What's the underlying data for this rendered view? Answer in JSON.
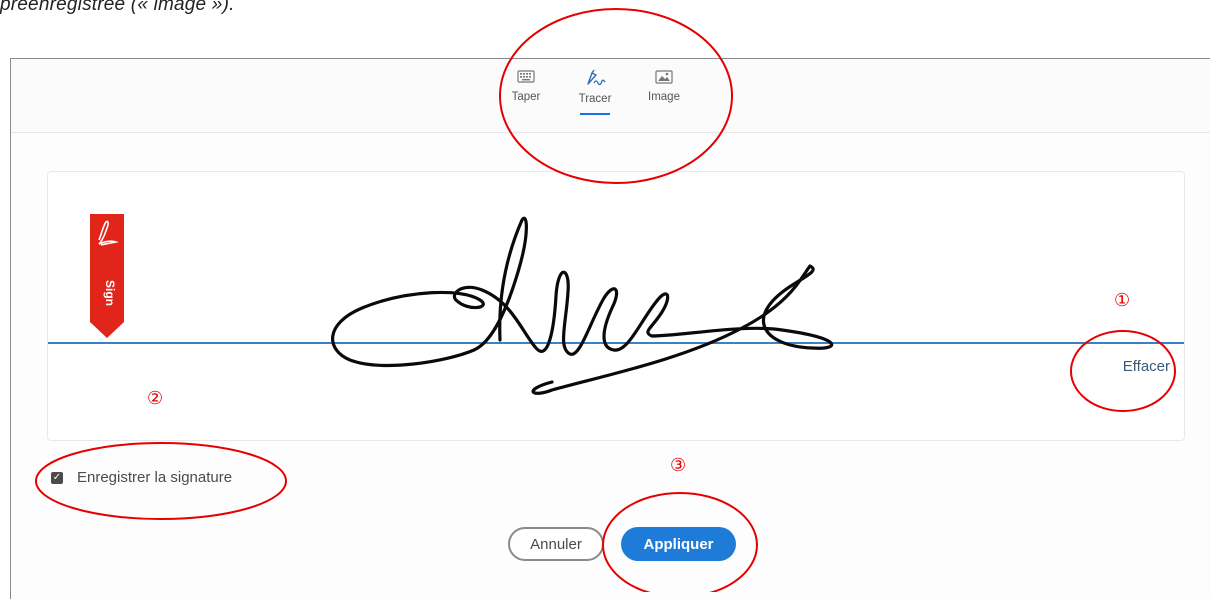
{
  "caption": "préenregistrée (« image »).",
  "tabs": [
    {
      "label": "Taper",
      "icon": "keyboard-icon",
      "active": false
    },
    {
      "label": "Tracer",
      "icon": "pen-icon",
      "active": true
    },
    {
      "label": "Image",
      "icon": "image-icon",
      "active": false
    }
  ],
  "sign_badge": {
    "label": "Sign",
    "icon": "acrobat-icon",
    "color": "#e1251b"
  },
  "signature_area": {
    "clear_label": "Effacer",
    "baseline_color": "#3b82c4"
  },
  "save_signature": {
    "label": "Enregistrer la signature",
    "checked": true
  },
  "buttons": {
    "cancel": "Annuler",
    "apply": "Appliquer",
    "apply_color": "#1f7bd8"
  },
  "annotations": {
    "marker_1": "①",
    "marker_2": "②",
    "marker_3": "③",
    "color": "#e60000"
  }
}
